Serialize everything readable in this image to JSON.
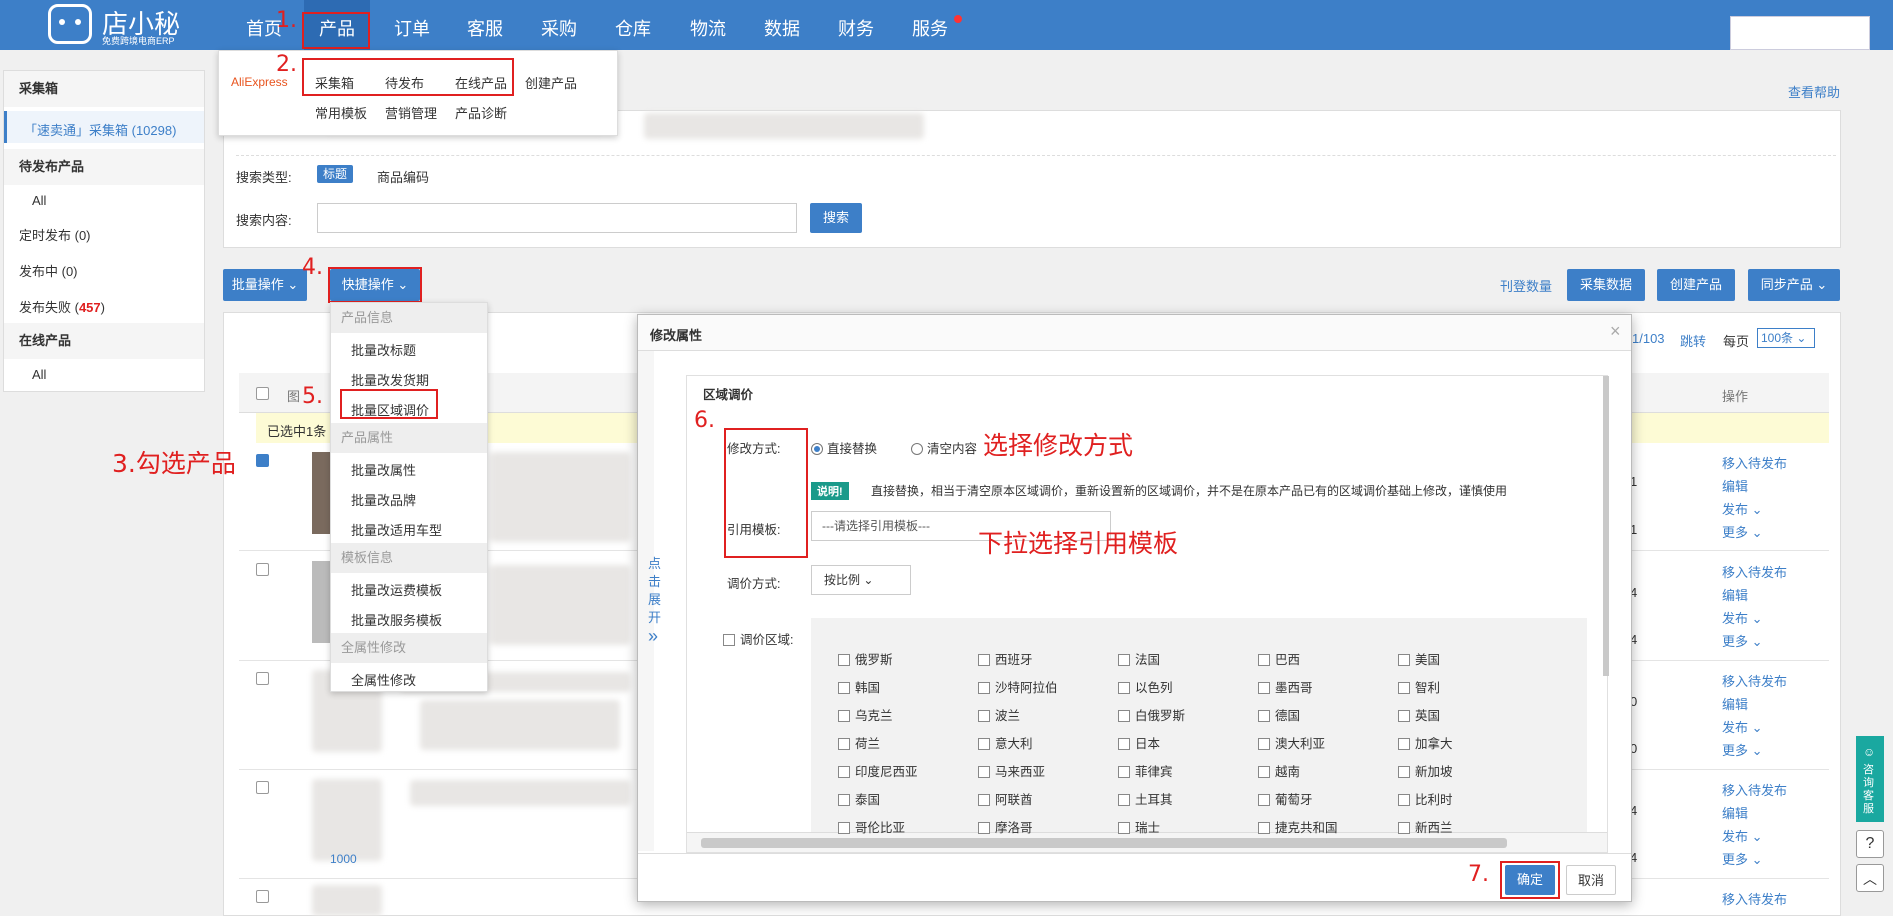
{
  "brand": {
    "name": "店小秘",
    "subtitle": "免费跨境电商ERP"
  },
  "nav": [
    "首页",
    "产品",
    "订单",
    "客服",
    "采购",
    "仓库",
    "物流",
    "数据",
    "财务",
    "服务"
  ],
  "product_menu": {
    "platform": "AliExpress",
    "row1": [
      "采集箱",
      "待发布",
      "在线产品",
      "创建产品"
    ],
    "row2": [
      "常用模板",
      "营销管理",
      "产品诊断"
    ]
  },
  "help_link": "查看帮助",
  "sidebar": {
    "collect_head": "采集箱",
    "collect_item": "「速卖通」采集箱 (10298)",
    "pending_head": "待发布产品",
    "pending_items": [
      "All",
      "定时发布 (0)",
      "发布中 (0)"
    ],
    "fail_label": "发布失败 (",
    "fail_count": "457",
    "fail_close": ")",
    "online_head": "在线产品",
    "online_items": [
      "All"
    ]
  },
  "search": {
    "type_label": "搜索类型:",
    "type_active": "标题",
    "type_other": "商品编码",
    "content_label": "搜索内容:",
    "button": "搜索"
  },
  "toolbar": {
    "batch": "批量操作",
    "quick": "快捷操作",
    "count_link": "刊登数量",
    "collect": "采集数据",
    "create": "创建产品",
    "sync": "同步产品"
  },
  "pager": {
    "pages": "1/103",
    "jump": "跳转",
    "per_page": "每页",
    "per_value": "100条"
  },
  "quick_menu": {
    "head1": "产品信息",
    "items1": [
      "批量改标题",
      "批量改发货期",
      "批量区域调价"
    ],
    "head2": "产品属性",
    "items2": [
      "批量改属性",
      "批量改品牌",
      "批量改适用车型"
    ],
    "head3": "模板信息",
    "items3": [
      "批量改运费模板",
      "批量改服务模板"
    ],
    "head4": "全属性修改",
    "items4": [
      "全属性修改"
    ]
  },
  "table": {
    "col_img": "图",
    "col_op": "操作",
    "selected": "已选中1条",
    "ops": [
      "移入待发布",
      "编辑",
      "发布",
      "更多"
    ],
    "row_nums": [
      "1",
      "1",
      "4",
      "4",
      "0",
      "0",
      "4",
      "4"
    ],
    "id_fragment": "1000"
  },
  "modal": {
    "title": "修改属性",
    "section": "区域调价",
    "side_toggle": [
      "点",
      "击",
      "展",
      "开"
    ],
    "mode_label": "修改方式:",
    "mode_options": [
      "直接替换",
      "清空内容"
    ],
    "note_tag": "说明!",
    "note": "直接替换，相当于清空原本区域调价，重新设置新的区域调价，并不是在原本产品已有的区域调价基础上修改，谨慎使用",
    "template_label": "引用模板:",
    "template_placeholder": "---请选择引用模板---",
    "price_label": "调价方式:",
    "price_value": "按比例",
    "region_label": "调价区域:",
    "regions": [
      [
        "俄罗斯",
        "西班牙",
        "法国",
        "巴西",
        "美国"
      ],
      [
        "韩国",
        "沙特阿拉伯",
        "以色列",
        "墨西哥",
        "智利"
      ],
      [
        "乌克兰",
        "波兰",
        "白俄罗斯",
        "德国",
        "英国"
      ],
      [
        "荷兰",
        "意大利",
        "日本",
        "澳大利亚",
        "加拿大"
      ],
      [
        "印度尼西亚",
        "马来西亚",
        "菲律宾",
        "越南",
        "新加坡"
      ],
      [
        "泰国",
        "阿联酋",
        "土耳其",
        "葡萄牙",
        "比利时"
      ],
      [
        "哥伦比亚",
        "摩洛哥",
        "瑞士",
        "捷克共和国",
        "新西兰"
      ]
    ],
    "confirm": "确定",
    "cancel": "取消"
  },
  "annotations": {
    "n1": "1.",
    "n2": "2.",
    "n3": "3.勾选产品",
    "n4": "4.",
    "n5": "5.",
    "n6": "6.",
    "n7": "7.",
    "mode_hint": "选择修改方式",
    "template_hint": "下拉选择引用模板"
  },
  "right_widget": {
    "consult": "咨询客服"
  },
  "colors": {
    "primary": "#3d7fc8",
    "annotation": "#e02020",
    "highlight_row": "#fdfbd5"
  }
}
